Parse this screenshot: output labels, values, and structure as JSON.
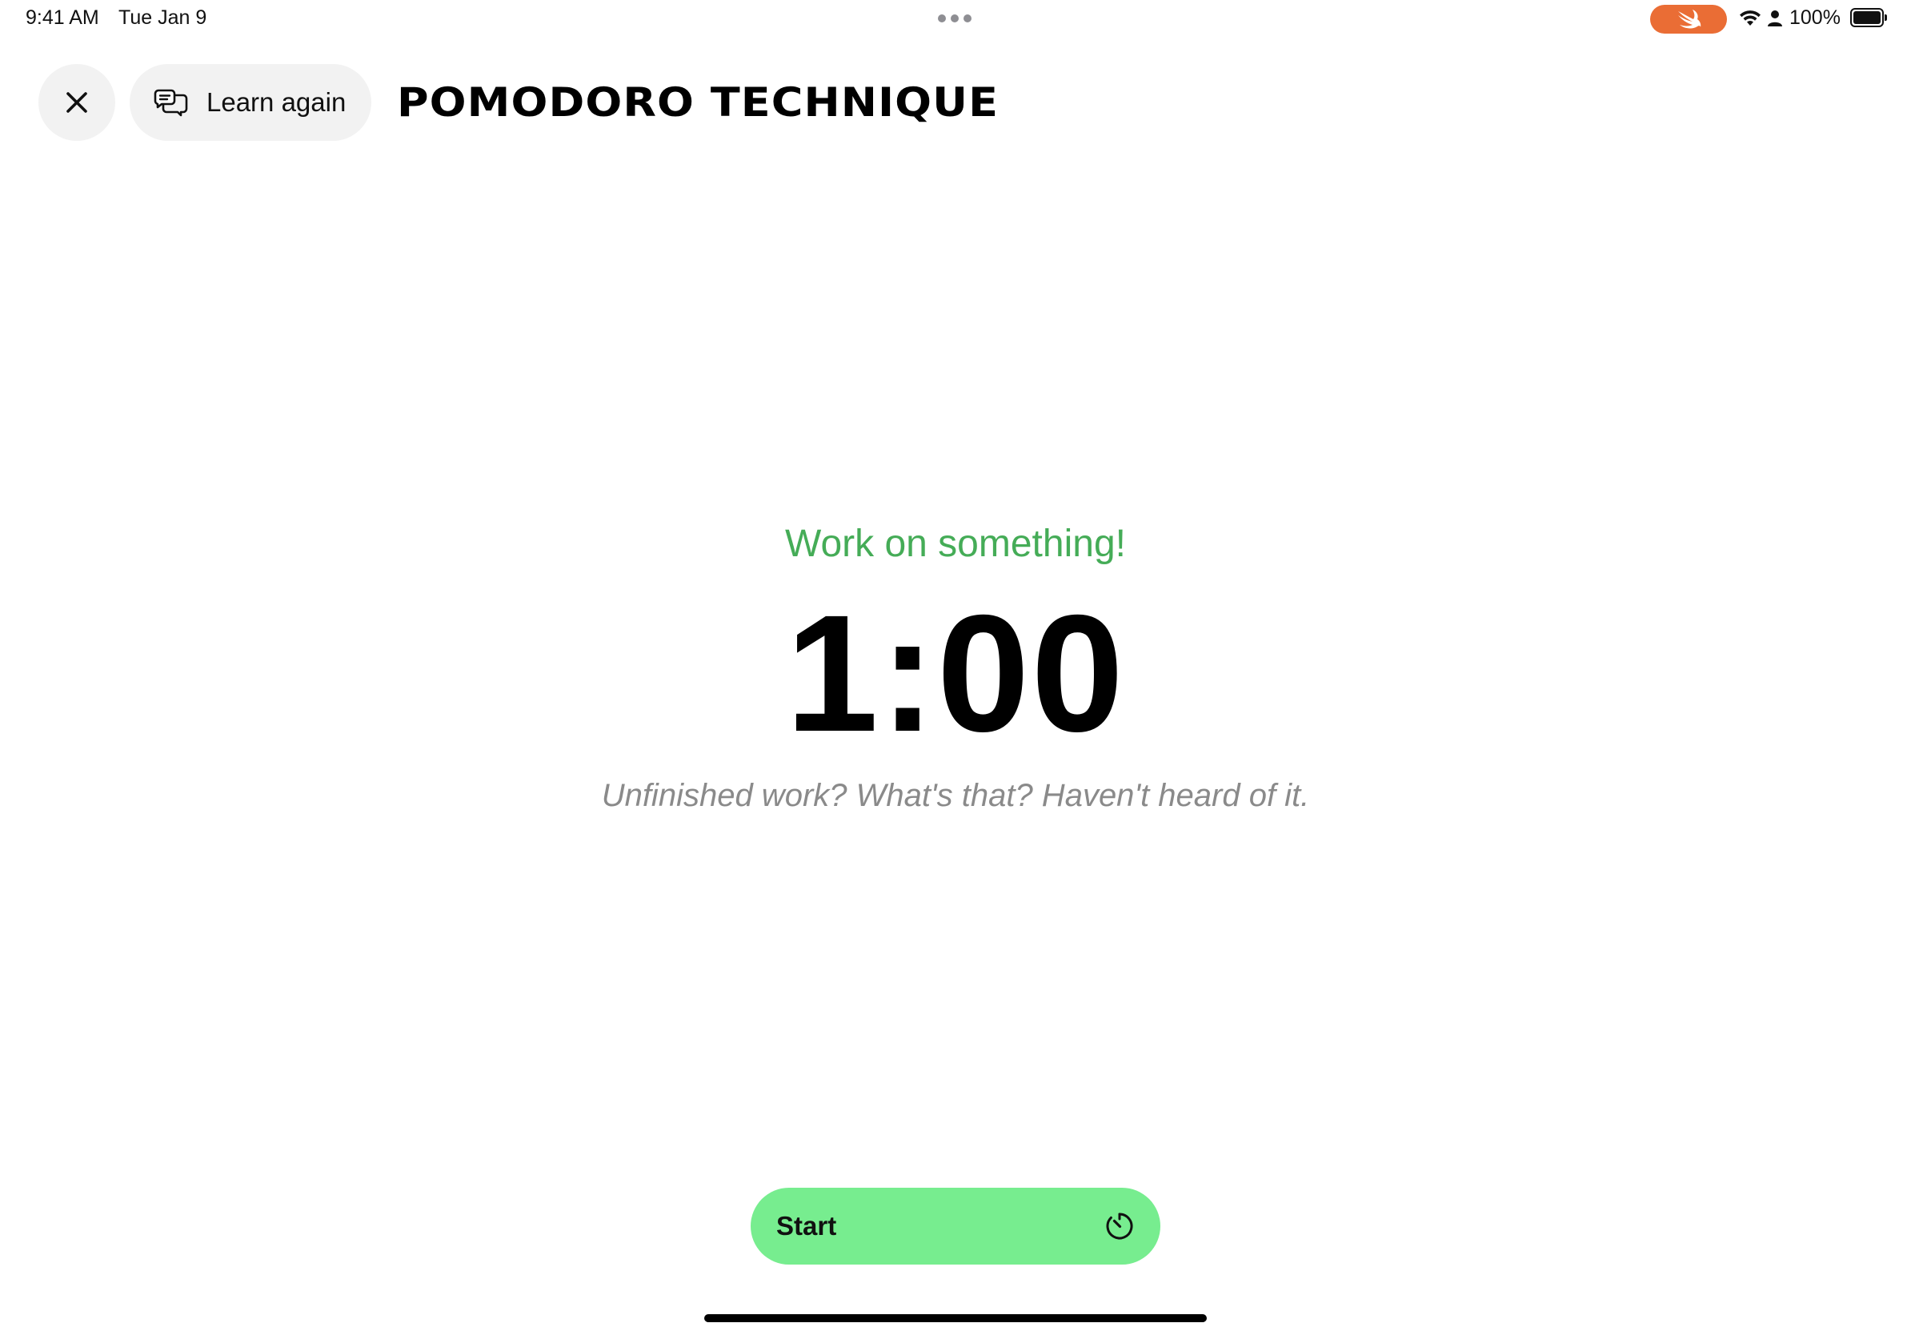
{
  "status_bar": {
    "time": "9:41 AM",
    "date": "Tue Jan 9",
    "battery_percent": "100%",
    "battery_level": 1.0,
    "icons": [
      "multitask-dots-icon",
      "swift-icon",
      "wifi-icon",
      "person-icon",
      "battery-icon"
    ],
    "swift_pill_color": "#ea6d35"
  },
  "header": {
    "close_icon": "close-icon",
    "learn_again_label": "Learn again",
    "learn_again_icon": "chat-bubbles-icon",
    "title": "POMODORO TECHNIQUE"
  },
  "timer": {
    "phase_label": "Work on something!",
    "phase_color": "#45ac57",
    "time_remaining": "1:00",
    "quote": "Unfinished work? What's that? Haven't heard of it."
  },
  "start_button": {
    "label": "Start",
    "icon": "timer-icon",
    "color": "#77ed8f"
  }
}
